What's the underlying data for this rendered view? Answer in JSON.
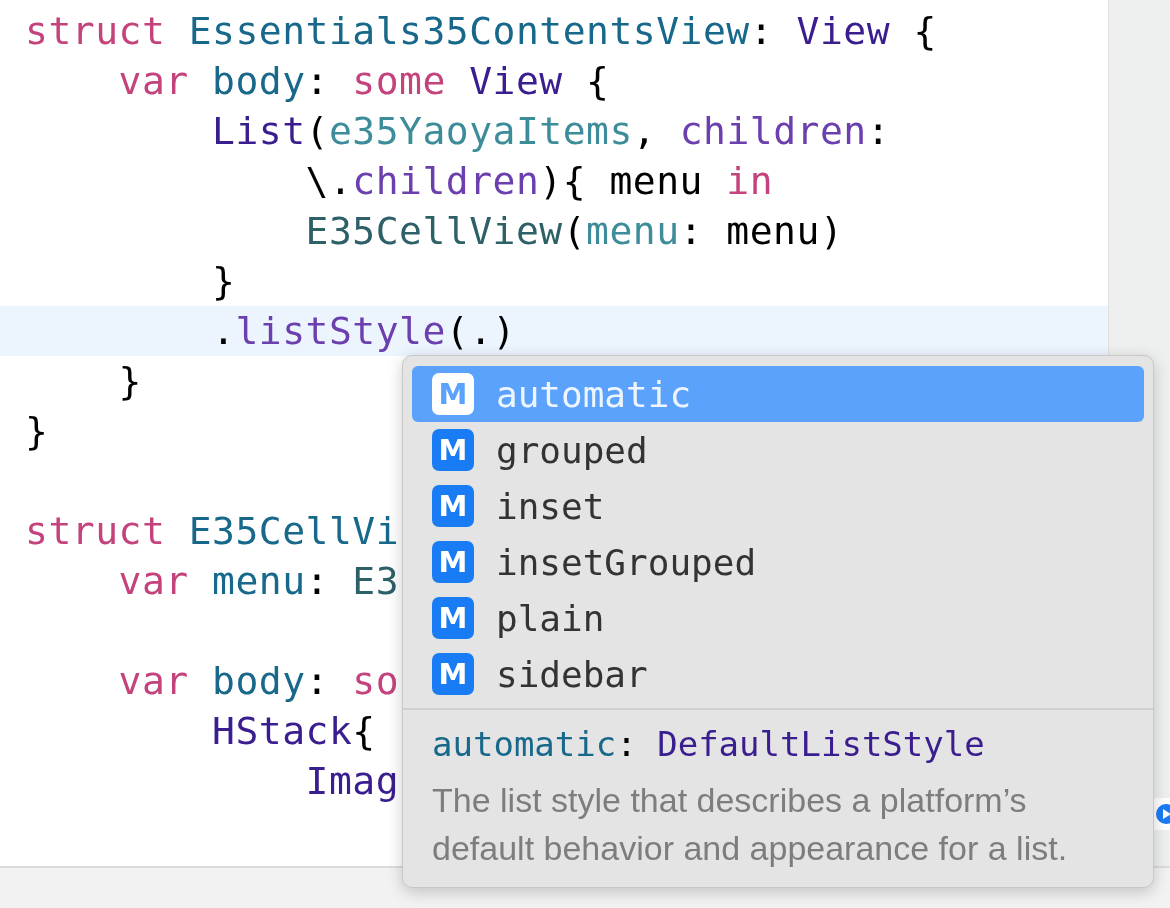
{
  "editor": {
    "lines": [
      {
        "kind": "code",
        "highlighted": false,
        "tokens": [
          {
            "kind": "keyword",
            "text": "struct "
          },
          {
            "kind": "decl",
            "text": "Essentials35ContentsView"
          },
          {
            "kind": "plain",
            "text": ": "
          },
          {
            "kind": "type",
            "text": "View"
          },
          {
            "kind": "plain",
            "text": " {"
          }
        ]
      },
      {
        "kind": "code",
        "highlighted": false,
        "tokens": [
          {
            "kind": "keyword",
            "text": "    var "
          },
          {
            "kind": "decl",
            "text": "body"
          },
          {
            "kind": "plain",
            "text": ": "
          },
          {
            "kind": "keyword",
            "text": "some "
          },
          {
            "kind": "type",
            "text": "View"
          },
          {
            "kind": "plain",
            "text": " {"
          }
        ]
      },
      {
        "kind": "code",
        "highlighted": false,
        "tokens": [
          {
            "kind": "type",
            "text": "        List"
          },
          {
            "kind": "plain",
            "text": "("
          },
          {
            "kind": "ident",
            "text": "e35YaoyaItems"
          },
          {
            "kind": "plain",
            "text": ", "
          },
          {
            "kind": "member",
            "text": "children"
          },
          {
            "kind": "plain",
            "text": ":"
          }
        ]
      },
      {
        "kind": "code",
        "highlighted": false,
        "tokens": [
          {
            "kind": "plain",
            "text": "            \\."
          },
          {
            "kind": "member",
            "text": "children"
          },
          {
            "kind": "plain",
            "text": "){ menu "
          },
          {
            "kind": "keyword",
            "text": "in"
          }
        ]
      },
      {
        "kind": "code",
        "highlighted": false,
        "tokens": [
          {
            "kind": "projtype",
            "text": "            E35CellView"
          },
          {
            "kind": "plain",
            "text": "("
          },
          {
            "kind": "ident",
            "text": "menu"
          },
          {
            "kind": "plain",
            "text": ": menu)"
          }
        ]
      },
      {
        "kind": "code",
        "highlighted": false,
        "tokens": [
          {
            "kind": "plain",
            "text": "        }"
          }
        ]
      },
      {
        "kind": "code",
        "highlighted": true,
        "tokens": [
          {
            "kind": "plain",
            "text": "        ."
          },
          {
            "kind": "member",
            "text": "listStyle"
          },
          {
            "kind": "plain",
            "text": "(.)"
          }
        ]
      },
      {
        "kind": "code",
        "highlighted": false,
        "tokens": [
          {
            "kind": "plain",
            "text": "    }"
          }
        ]
      },
      {
        "kind": "code",
        "highlighted": false,
        "tokens": [
          {
            "kind": "plain",
            "text": "}"
          }
        ]
      },
      {
        "kind": "blank"
      },
      {
        "kind": "code",
        "highlighted": false,
        "tokens": [
          {
            "kind": "keyword",
            "text": "struct "
          },
          {
            "kind": "decl",
            "text": "E35CellVi"
          }
        ]
      },
      {
        "kind": "code",
        "highlighted": false,
        "tokens": [
          {
            "kind": "keyword",
            "text": "    var "
          },
          {
            "kind": "decl",
            "text": "menu"
          },
          {
            "kind": "plain",
            "text": ": "
          },
          {
            "kind": "projtype",
            "text": "E3"
          }
        ]
      },
      {
        "kind": "blank"
      },
      {
        "kind": "code",
        "highlighted": false,
        "tokens": [
          {
            "kind": "keyword",
            "text": "    var "
          },
          {
            "kind": "decl",
            "text": "body"
          },
          {
            "kind": "plain",
            "text": ": "
          },
          {
            "kind": "keyword",
            "text": "so"
          }
        ]
      },
      {
        "kind": "code",
        "highlighted": false,
        "tokens": [
          {
            "kind": "type",
            "text": "        HStack"
          },
          {
            "kind": "plain",
            "text": "{"
          }
        ]
      },
      {
        "kind": "code",
        "highlighted": false,
        "tokens": [
          {
            "kind": "type",
            "text": "            Imag"
          }
        ]
      }
    ]
  },
  "completion": {
    "items": [
      {
        "badge": "M",
        "label": "automatic",
        "selected": true
      },
      {
        "badge": "M",
        "label": "grouped",
        "selected": false
      },
      {
        "badge": "M",
        "label": "inset",
        "selected": false
      },
      {
        "badge": "M",
        "label": "insetGrouped",
        "selected": false
      },
      {
        "badge": "M",
        "label": "plain",
        "selected": false
      },
      {
        "badge": "M",
        "label": "sidebar",
        "selected": false
      }
    ],
    "signature": [
      {
        "kind": "decl",
        "text": "automatic"
      },
      {
        "kind": "plain",
        "text": ": "
      },
      {
        "kind": "type",
        "text": "DefaultListStyle"
      }
    ],
    "description": "The list style that describes a platform’s default behavior and appearance for a list."
  }
}
